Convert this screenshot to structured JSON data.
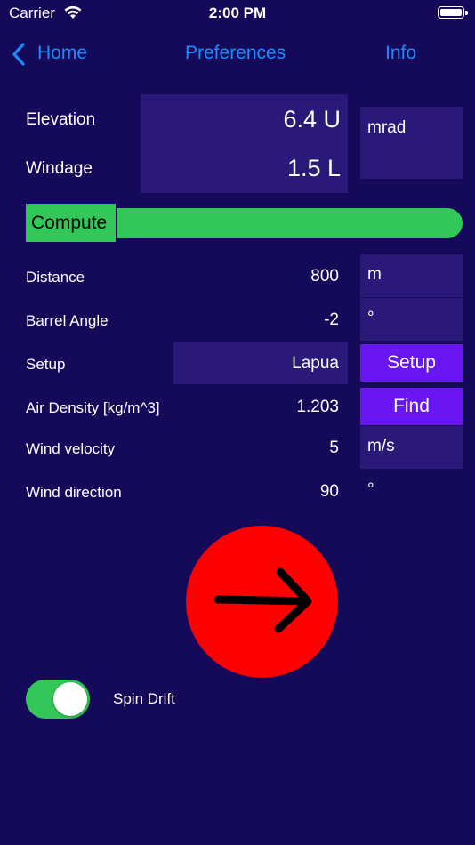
{
  "status_bar": {
    "carrier": "Carrier",
    "time": "2:00 PM"
  },
  "nav": {
    "back_label": "Home",
    "center_label": "Preferences",
    "right_label": "Info"
  },
  "results": {
    "elevation_label": "Elevation",
    "elevation_value": "6.4 U",
    "windage_label": "Windage",
    "windage_value": "1.5 L",
    "unit": "mrad"
  },
  "compute": {
    "label": "Compute"
  },
  "inputs": {
    "distance": {
      "label": "Distance",
      "value": "800",
      "unit": "m"
    },
    "barrel_angle": {
      "label": "Barrel Angle",
      "value": "-2",
      "unit": "°"
    },
    "setup": {
      "label": "Setup",
      "value": "Lapua",
      "button": "Setup"
    },
    "air_density": {
      "label": "Air Density [kg/m^3]",
      "value": "1.203",
      "button": "Find"
    },
    "wind_velocity": {
      "label": "Wind velocity",
      "value": "5",
      "unit": "m/s"
    },
    "wind_direction": {
      "label": "Wind direction",
      "value": "90",
      "unit": "°"
    }
  },
  "spin_drift": {
    "label": "Spin Drift",
    "enabled": true
  },
  "colors": {
    "background": "#15095a",
    "panel": "#2a1978",
    "accent_purple": "#6a16f2",
    "green": "#33c759",
    "red": "#ff0000",
    "link": "#1e8bff"
  },
  "icons": {
    "back": "chevron-left-icon",
    "wind": "arrow-right-icon",
    "wifi": "wifi-icon",
    "battery": "battery-icon"
  }
}
